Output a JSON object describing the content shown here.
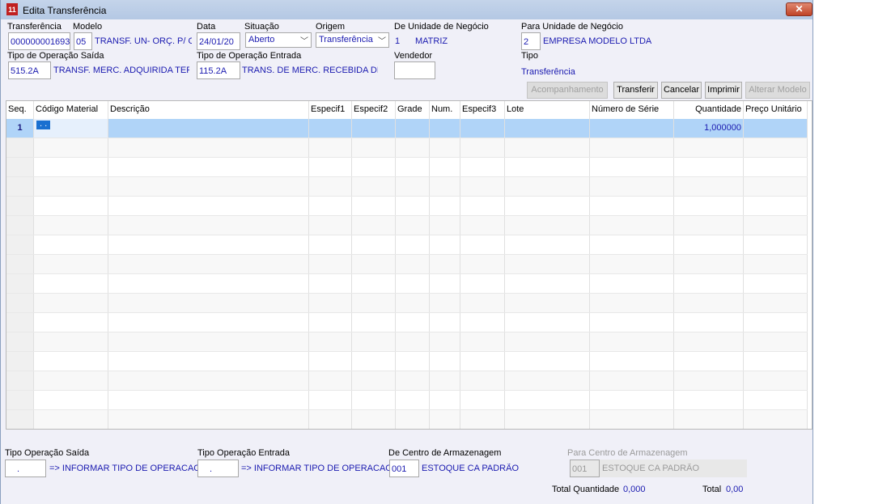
{
  "window": {
    "title": "Edita Transferência",
    "close_icon": "close-icon"
  },
  "header": {
    "transferencia": {
      "label": "Transferência",
      "value": "000000001693"
    },
    "modelo": {
      "label": "Modelo",
      "code": "05",
      "desc": "TRANSF. UN- ORÇ. P/ OC"
    },
    "data": {
      "label": "Data",
      "value": "24/01/20"
    },
    "situacao": {
      "label": "Situação",
      "value": "Aberto"
    },
    "origem": {
      "label": "Origem",
      "value": "Transferência"
    },
    "de_unidade": {
      "label": "De Unidade de Negócio",
      "code": "1",
      "name": "MATRIZ"
    },
    "para_unidade": {
      "label": "Para Unidade de Negócio",
      "code": "2",
      "name": "EMPRESA MODELO LTDA"
    },
    "tipo_saida": {
      "label": "Tipo de Operação Saída",
      "code": "515.2A",
      "desc": "TRANSF. MERC. ADQUIRIDA TERC"
    },
    "tipo_entrada": {
      "label": "Tipo de Operação Entrada",
      "code": "115.2A",
      "desc": "TRANS. DE MERC. RECEBIDA DE TE"
    },
    "vendedor": {
      "label": "Vendedor",
      "value": ""
    },
    "tipo": {
      "label": "Tipo",
      "value": "Transferência"
    }
  },
  "buttons": {
    "acompanhamento": "Acompanhamento",
    "transferir": "Transferir",
    "cancelar": "Cancelar",
    "imprimir": "Imprimir",
    "alterar_modelo": "Alterar Modelo"
  },
  "grid": {
    "columns": [
      "Seq.",
      "Código Material",
      "Descrição",
      "Especif1",
      "Especif2",
      "Grade",
      "Num.",
      "Especif3",
      "Lote",
      "Número de Série",
      "Quantidade",
      "Preço Unitário"
    ],
    "rows": [
      {
        "seq": "1",
        "codigo": ". .",
        "quantidade": "1,000000"
      }
    ]
  },
  "footer": {
    "tipo_saida": {
      "label": "Tipo Operação Saída",
      "code": ".",
      "desc": "=> INFORMAR TIPO DE OPERACAO"
    },
    "tipo_entrada": {
      "label": "Tipo Operação Entrada",
      "code": ".",
      "desc": "=> INFORMAR TIPO DE OPERACAO"
    },
    "de_centro": {
      "label": "De Centro de Armazenagem",
      "code": "001",
      "desc": "ESTOQUE CA PADRÃO"
    },
    "para_centro": {
      "label": "Para Centro de Armazenagem",
      "code": "001",
      "desc": "ESTOQUE CA PADRÃO"
    },
    "total_quantidade": {
      "label": "Total Quantidade",
      "value": "0,000"
    },
    "total": {
      "label": "Total",
      "value": "0,00"
    }
  }
}
